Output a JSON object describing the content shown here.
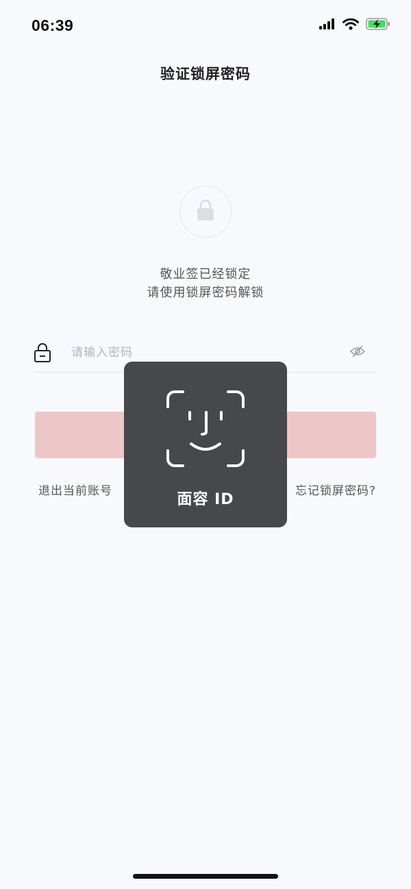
{
  "status_bar": {
    "time": "06:39",
    "icons": [
      "cellular-signal-icon",
      "wifi-icon",
      "battery-charging-icon"
    ]
  },
  "header": {
    "title": "验证锁屏密码"
  },
  "lock_status": {
    "icon": "lock-icon",
    "line1": "敬业签已经锁定",
    "line2": "请使用锁屏密码解锁"
  },
  "password_field": {
    "icon": "lock-icon",
    "value": "",
    "placeholder": "请输入密码",
    "visibility_icon": "eye-slash-icon"
  },
  "confirm_button": {
    "label": ""
  },
  "links": {
    "logout": "退出当前账号",
    "forgot": "忘记锁屏密码?"
  },
  "faceid": {
    "icon": "face-id-icon",
    "label": "面容 ID"
  },
  "colors": {
    "background": "#f8f9fc",
    "button_disabled": "#edc6c8",
    "overlay": "#47484c"
  }
}
